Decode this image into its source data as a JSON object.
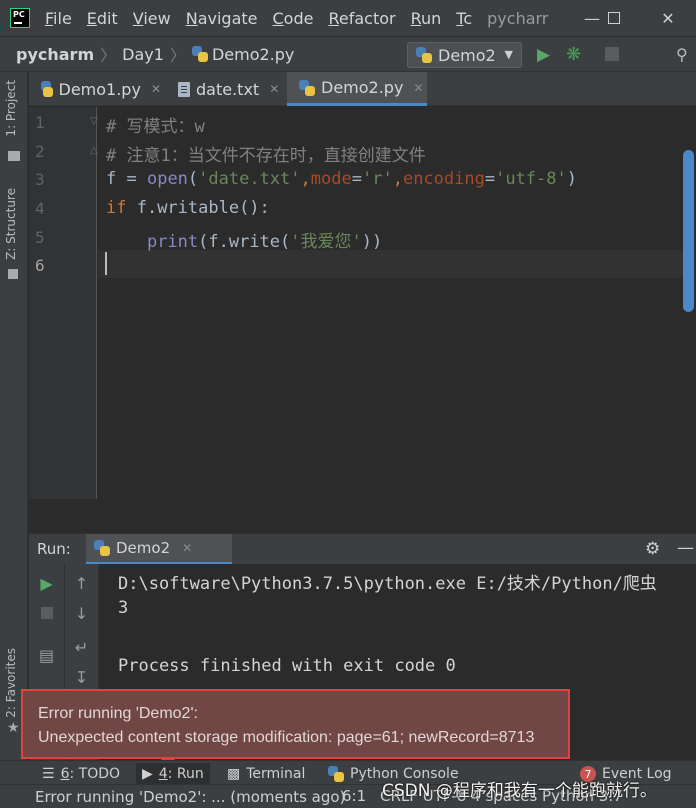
{
  "menubar": {
    "items": [
      {
        "mnemonic": "F",
        "rest": "ile"
      },
      {
        "mnemonic": "E",
        "rest": "dit"
      },
      {
        "mnemonic": "V",
        "rest": "iew"
      },
      {
        "mnemonic": "N",
        "rest": "avigate"
      },
      {
        "mnemonic": "C",
        "rest": "ode"
      },
      {
        "mnemonic": "R",
        "rest": "efactor"
      },
      {
        "mnemonic": "R",
        "rest": "un"
      },
      {
        "mnemonic": "T",
        "rest": "c"
      }
    ],
    "window_title": "pycharr",
    "logo_text": "PC"
  },
  "navbar": {
    "crumbs": [
      "pycharm",
      "Day1",
      "Demo2.py"
    ],
    "run_config": "Demo2"
  },
  "left_strip": {
    "project": "1: Project",
    "structure": "Z: Structure",
    "favorites": "2: Favorites"
  },
  "tabs": [
    {
      "label": "Demo1.py",
      "icon": "python-file-icon"
    },
    {
      "label": "date.txt",
      "icon": "text-file-icon"
    },
    {
      "label": "Demo2.py",
      "icon": "python-file-icon",
      "active": true
    }
  ],
  "editor": {
    "line_numbers": [
      "1",
      "2",
      "3",
      "4",
      "5",
      "6"
    ],
    "current_line": 6,
    "code": {
      "l1": "# 写模式：w",
      "l2": "# 注意1：当文件不存在时，直接创建文件",
      "l3": {
        "var": "f",
        "eq": " = ",
        "fn": "open",
        "p1": "(",
        "s1": "'date.txt'",
        "c1": ",",
        "k1": "mode",
        "e1": "=",
        "s2": "'r'",
        "c2": ",",
        "k2": "encoding",
        "e2": "=",
        "s3": "'utf-8'",
        "p2": ")"
      },
      "l4": {
        "kw": "if",
        "rest": " f.writable():"
      },
      "l5": {
        "indent": "    ",
        "fn": "print",
        "pre": "(f.write(",
        "str": "'我爱您'",
        "post": "))"
      }
    }
  },
  "run_window": {
    "title": "Run:",
    "tab": "Demo2",
    "console": [
      "D:\\software\\Python3.7.5\\python.exe E:/技术/Python/爬虫",
      "3",
      "",
      "Process finished with exit code 0"
    ]
  },
  "error_balloon": {
    "title": "Error running 'Demo2':",
    "message": "Unexpected content storage modification: page=61; newRecord=8713"
  },
  "tool_windows": {
    "todo": {
      "u": "6",
      "rest": ": TODO"
    },
    "run": {
      "u": "4",
      "rest": ": Run"
    },
    "terminal": "Terminal",
    "python_console": "Python Console",
    "event_log": "Event Log",
    "event_count": "7"
  },
  "statusbar": {
    "message": "Error running 'Demo2': ... (moments ago)",
    "position": "6:1",
    "encoding_partial": "CRLF  UTF-8  4 spaces  Python 3.7"
  },
  "watermark": "CSDN @程序和我有一个能跑就行。"
}
